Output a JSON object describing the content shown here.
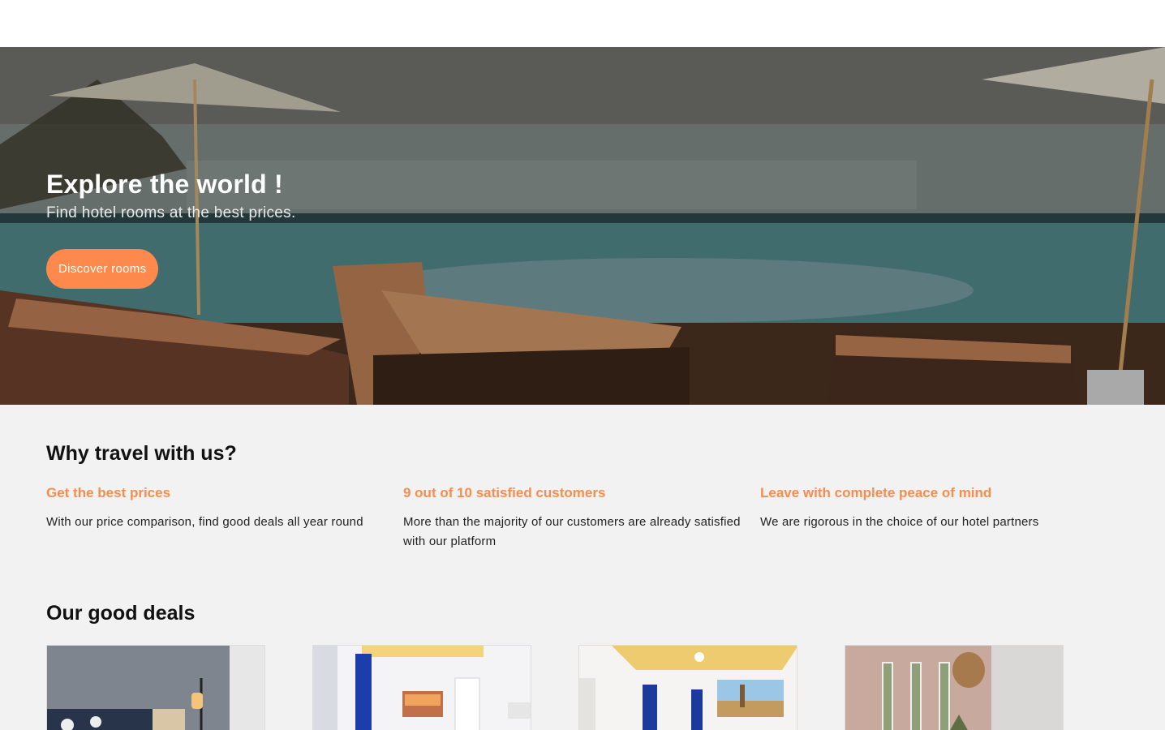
{
  "hero": {
    "title": "Explore the world !",
    "subtitle": "Find hotel rooms at the best prices.",
    "button_label": "Discover rooms"
  },
  "why": {
    "title": "Why travel with us?",
    "features": [
      {
        "title": "Get the best prices",
        "text": "With our price comparison, find good deals all year round"
      },
      {
        "title": "9 out of 10 satisfied customers",
        "text": "More than the majority of our customers are already satisfied with our platform"
      },
      {
        "title": "Leave with complete peace of mind",
        "text": "We are rigorous in the choice of our hotel partners"
      }
    ]
  },
  "deals": {
    "title": "Our good deals",
    "cards": [
      {
        "image": "bedroom-lamp-photo"
      },
      {
        "image": "room-blue-curtains-photo"
      },
      {
        "image": "room-london-painting-photo"
      },
      {
        "image": "room-plant-window-photo"
      }
    ]
  },
  "colors": {
    "accent": "#fd8a4c",
    "feature_title": "#f78c4e",
    "background": "#f3f2f2"
  }
}
